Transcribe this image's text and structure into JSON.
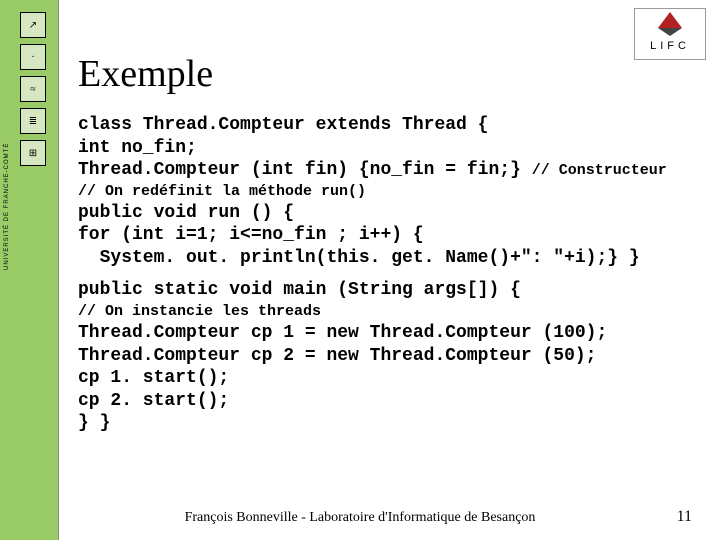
{
  "sidebar": {
    "institution": "UNIVERSITÉ DE FRANCHE-COMTÉ"
  },
  "logo": {
    "text": "LIFC"
  },
  "title": "Exemple",
  "code": {
    "line1": "class Thread.Compteur extends Thread {",
    "line2": "int no_fin;",
    "line3a": "Thread.Compteur (int fin) {no_fin = fin;} ",
    "line3b": "// Constructeur",
    "comment1": "// On redéfinit la méthode run()",
    "line4": "public void run () {",
    "line5": "for (int i=1; i<=no_fin ; i++) {",
    "line6": "  System. out. println(this. get. Name()+\": \"+i);} }",
    "line7": "public static void main (String args[]) {",
    "comment2": "// On instancie les threads",
    "line8": "Thread.Compteur cp 1 = new Thread.Compteur (100);",
    "line9": "Thread.Compteur cp 2 = new Thread.Compteur (50);",
    "line10": "cp 1. start();",
    "line11": "cp 2. start();",
    "line12": "} }"
  },
  "footer": "François Bonneville - Laboratoire d'Informatique de Besançon",
  "page": "11"
}
